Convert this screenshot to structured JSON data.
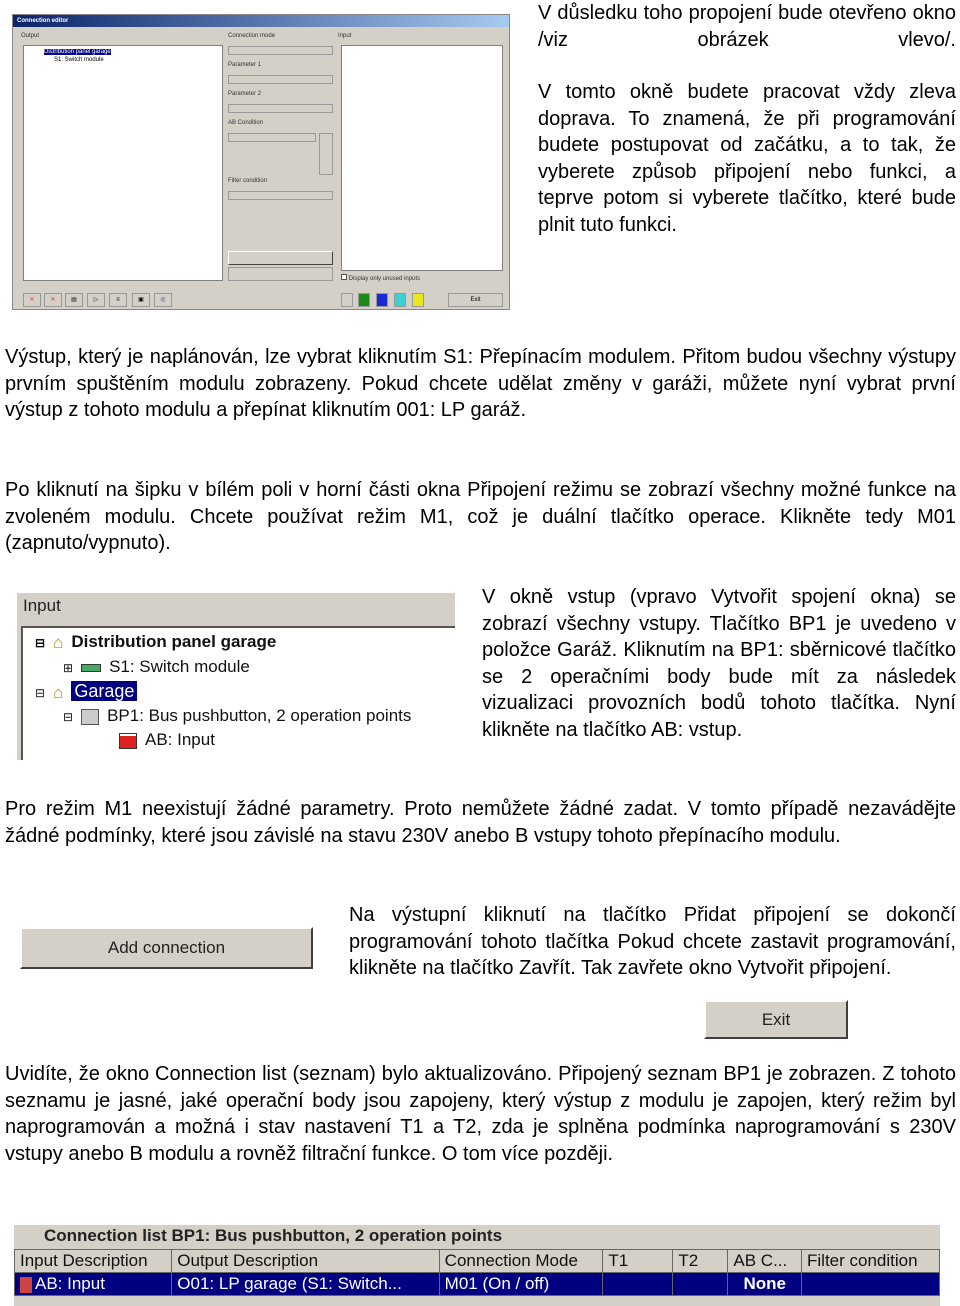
{
  "editor": {
    "title": "Connection editor",
    "output_label": "Output",
    "connection_mode": "Connection mode",
    "param1": "Parameter 1",
    "param2": "Parameter 2",
    "ab_condition": "AB Condition",
    "filter": "Filter condition",
    "input_label": "Input",
    "display_unused": "Display only unused inputs",
    "exit": "Exit",
    "tree": [
      "Distribution panel garage",
      "S1: Switch module"
    ]
  },
  "text": {
    "p1": "V důsledku toho propojení bude otevřeno okno /viz obrázek vlevo/.",
    "p2": "V tomto okně budete pracovat vždy zleva doprava. To znamená, že při programování budete postupovat od začátku, a to tak, že vyberete způsob připojení nebo funkci, a teprve potom si vyberete tlačítko, které bude plnit tuto funkci.",
    "p3": "Výstup, který je naplánován, lze vybrat kliknutím S1: Přepínacím modulem. Přitom budou všechny výstupy prvním spuštěním modulu zobrazeny. Pokud chcete udělat změny v garáži, můžete nyní vybrat první výstup z tohoto modulu a přepínat kliknutím 001: LP garáž.",
    "p4": "Po kliknutí na šipku v bílém poli v horní části okna Připojení režimu se zobrazí všechny možné funkce na zvoleném modulu. Chcete používat režim M1, což je duální tlačítko operace. Klikněte tedy M01 (zapnuto/vypnuto).",
    "p5": "V okně vstup (vpravo Vytvořit spojení okna) se zobrazí všechny vstupy. Tlačítko BP1 je uvedeno v položce Garáž. Kliknutím na BP1: sběrnicové tlačítko se 2 operačními body bude mít za následek vizualizaci provozních bodů tohoto tlačítka. Nyní klikněte na tlačítko AB: vstup.",
    "p6": "Pro režim M1 neexistují žádné parametry. Proto nemůžete žádné zadat. V tomto případě nezavádějte žádné podmínky, které jsou závislé na stavu 230V anebo B vstupy tohoto přepínacího modulu.",
    "p7": "Na výstupní kliknutí na tlačítko Přidat připojení se dokončí programování tohoto tlačítka Pokud chcete zastavit programování, klikněte na tlačítko Zavřít. Tak zavřete okno Vytvořit připojení.",
    "p8": "Uvidíte, že okno Connection list (seznam) bylo aktualizováno. Připojený seznam BP1 je zobrazen. Z tohoto seznamu je jasné, jaké operační body jsou zapojeny, který výstup z modulu je zapojen, který režim byl naprogramován a možná i stav nastavení T1 a T2, zda je splněna podmínka naprogramování s 230V vstupy anebo B modulu a rovněž filtrační funkce. O tom více později."
  },
  "input_panel": {
    "label": "Input",
    "items": [
      "Distribution panel garage",
      "S1: Switch module",
      "Garage",
      "BP1: Bus pushbutton, 2 operation points",
      "AB: Input"
    ]
  },
  "add_connection": "Add connection",
  "exit_button": "Exit",
  "conn_list": {
    "title": "Connection list BP1: Bus pushbutton, 2 operation points",
    "headers": [
      "Input Description",
      "Output Description",
      "Connection Mode",
      "T1",
      "T2",
      "AB C...",
      "Filter condition"
    ],
    "row": [
      "AB: Input",
      "O01: LP garage (S1: Switch...",
      "M01 (On / off)",
      "",
      "",
      "None",
      ""
    ]
  },
  "colors": {
    "selection": "#000080",
    "window": "#d4d0c8"
  }
}
